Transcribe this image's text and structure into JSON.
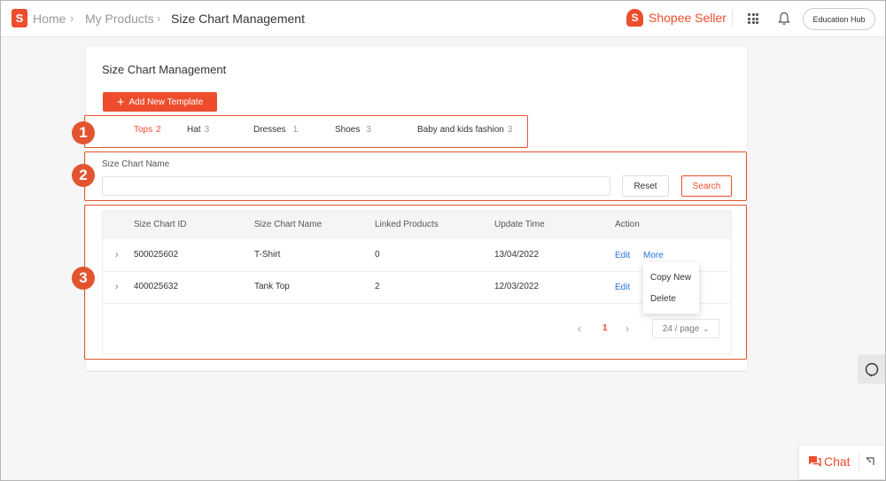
{
  "breadcrumb": {
    "home": "Home",
    "products": "My Products",
    "current": "Size Chart Management"
  },
  "header": {
    "brand": "Shopee Seller",
    "education_hub": "Education Hub"
  },
  "page": {
    "title": "Size Chart Management",
    "add_button": "Add New Template"
  },
  "tabs": [
    {
      "label": "Tops",
      "count": "2",
      "active": true
    },
    {
      "label": "Hat",
      "count": "3"
    },
    {
      "label": "Dresses",
      "count": "1"
    },
    {
      "label": "Shoes",
      "count": "3"
    },
    {
      "label": "Baby and kids fashion",
      "count": "3"
    }
  ],
  "filter": {
    "label": "Size Chart Name",
    "value": "",
    "reset": "Reset",
    "search": "Search"
  },
  "table": {
    "columns": [
      "Size Chart ID",
      "Size Chart Name",
      "Linked Products",
      "Update Time",
      "Action"
    ],
    "rows": [
      {
        "id": "500025602",
        "name": "T-Shirt",
        "linked": "0",
        "updated": "13/04/2022",
        "edit": "Edit",
        "more": "More"
      },
      {
        "id": "400025632",
        "name": "Tank Top",
        "linked": "2",
        "updated": "12/03/2022",
        "edit": "Edit"
      }
    ]
  },
  "more_menu": {
    "items": [
      "Copy New",
      "Delete"
    ]
  },
  "pagination": {
    "current": "1",
    "page_size": "24 / page"
  },
  "annotations": [
    "1",
    "2",
    "3"
  ],
  "chat": {
    "label": "Chat"
  },
  "colors": {
    "brand": "#ee4d2d",
    "annotation": "#e2542f",
    "link": "#2673dd"
  }
}
